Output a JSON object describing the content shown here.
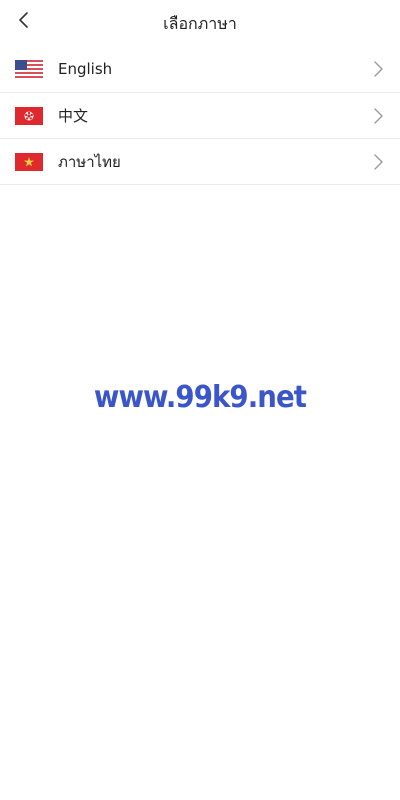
{
  "header": {
    "title": "เลือกภาษา",
    "back_icon": "chevron-left-icon"
  },
  "languages": [
    {
      "label": "English",
      "flag_icon": "us-flag-icon"
    },
    {
      "label": "中文",
      "flag_icon": "hong-kong-flag-icon"
    },
    {
      "label": "ภาษาไทย",
      "flag_icon": "vietnam-flag-icon"
    }
  ],
  "row_chevron_icon": "chevron-right-icon",
  "watermark": {
    "text": "www.99k9.net",
    "color": "#3a56c8"
  },
  "colors": {
    "background": "#ffffff",
    "divider": "#e9e9e9",
    "text": "#222222",
    "chevron": "#9a9a9a"
  }
}
